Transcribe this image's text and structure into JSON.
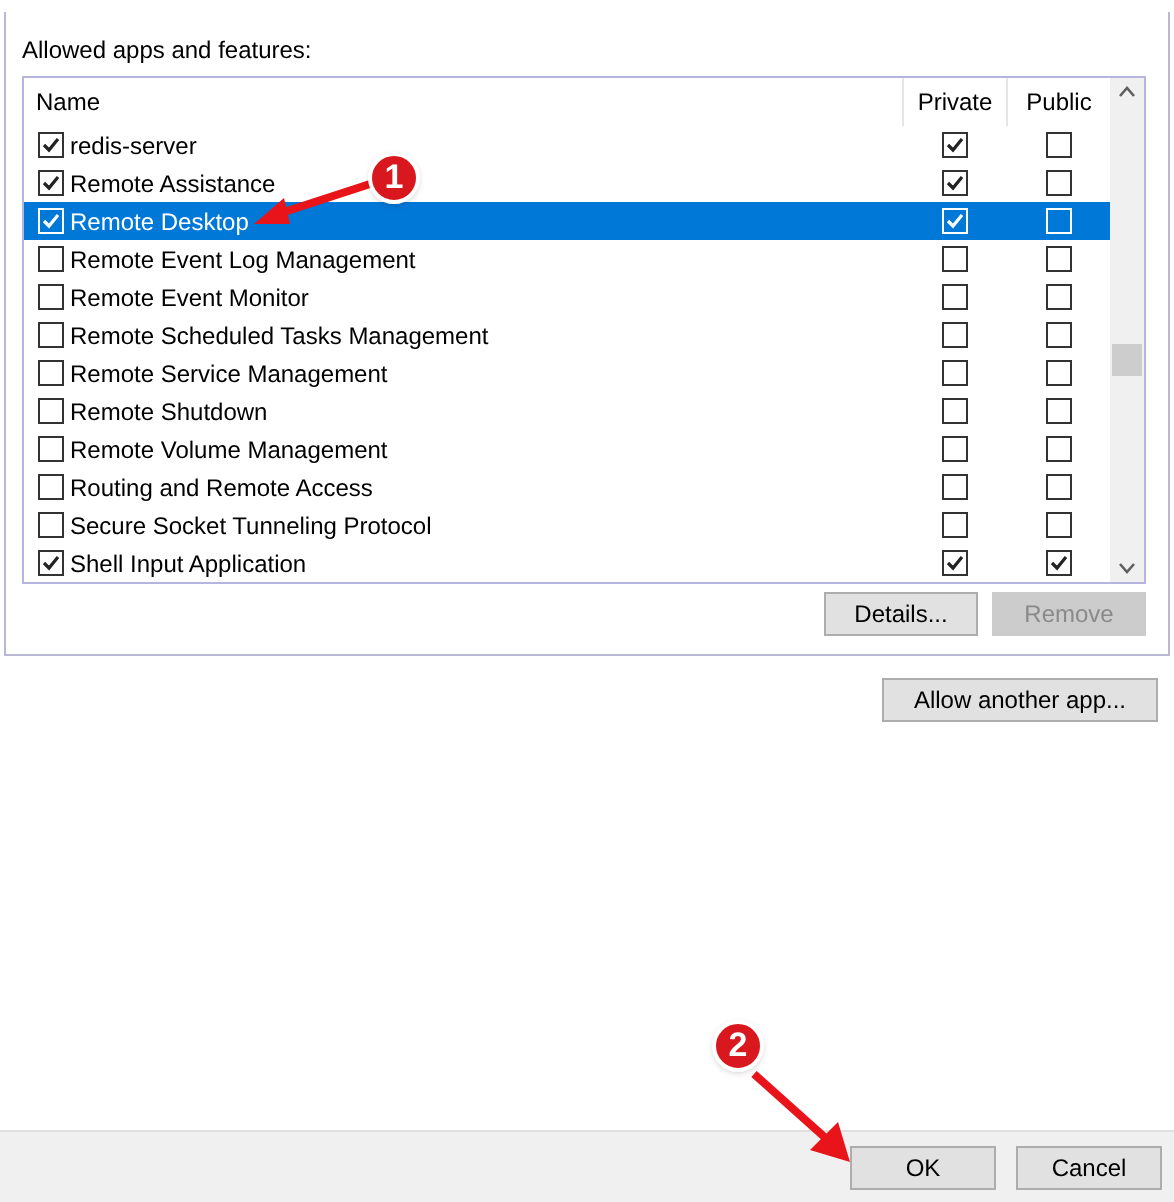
{
  "section_label": "Allowed apps and features:",
  "table": {
    "columns": [
      "Name",
      "Private",
      "Public"
    ],
    "rows": [
      {
        "name": "redis-server",
        "enabled": true,
        "private": true,
        "public": false,
        "selected": false
      },
      {
        "name": "Remote Assistance",
        "enabled": true,
        "private": true,
        "public": false,
        "selected": false
      },
      {
        "name": "Remote Desktop",
        "enabled": true,
        "private": true,
        "public": false,
        "selected": true
      },
      {
        "name": "Remote Event Log Management",
        "enabled": false,
        "private": false,
        "public": false,
        "selected": false
      },
      {
        "name": "Remote Event Monitor",
        "enabled": false,
        "private": false,
        "public": false,
        "selected": false
      },
      {
        "name": "Remote Scheduled Tasks Management",
        "enabled": false,
        "private": false,
        "public": false,
        "selected": false
      },
      {
        "name": "Remote Service Management",
        "enabled": false,
        "private": false,
        "public": false,
        "selected": false
      },
      {
        "name": "Remote Shutdown",
        "enabled": false,
        "private": false,
        "public": false,
        "selected": false
      },
      {
        "name": "Remote Volume Management",
        "enabled": false,
        "private": false,
        "public": false,
        "selected": false
      },
      {
        "name": "Routing and Remote Access",
        "enabled": false,
        "private": false,
        "public": false,
        "selected": false
      },
      {
        "name": "Secure Socket Tunneling Protocol",
        "enabled": false,
        "private": false,
        "public": false,
        "selected": false
      },
      {
        "name": "Shell Input Application",
        "enabled": true,
        "private": true,
        "public": true,
        "selected": false
      }
    ]
  },
  "list_buttons": [
    {
      "label": "Details...",
      "disabled": false
    },
    {
      "label": "Remove",
      "disabled": true
    }
  ],
  "allow_button": "Allow another app...",
  "footer_buttons": [
    {
      "label": "OK",
      "disabled": false
    },
    {
      "label": "Cancel",
      "disabled": false
    }
  ],
  "callouts": [
    "1",
    "2"
  ]
}
